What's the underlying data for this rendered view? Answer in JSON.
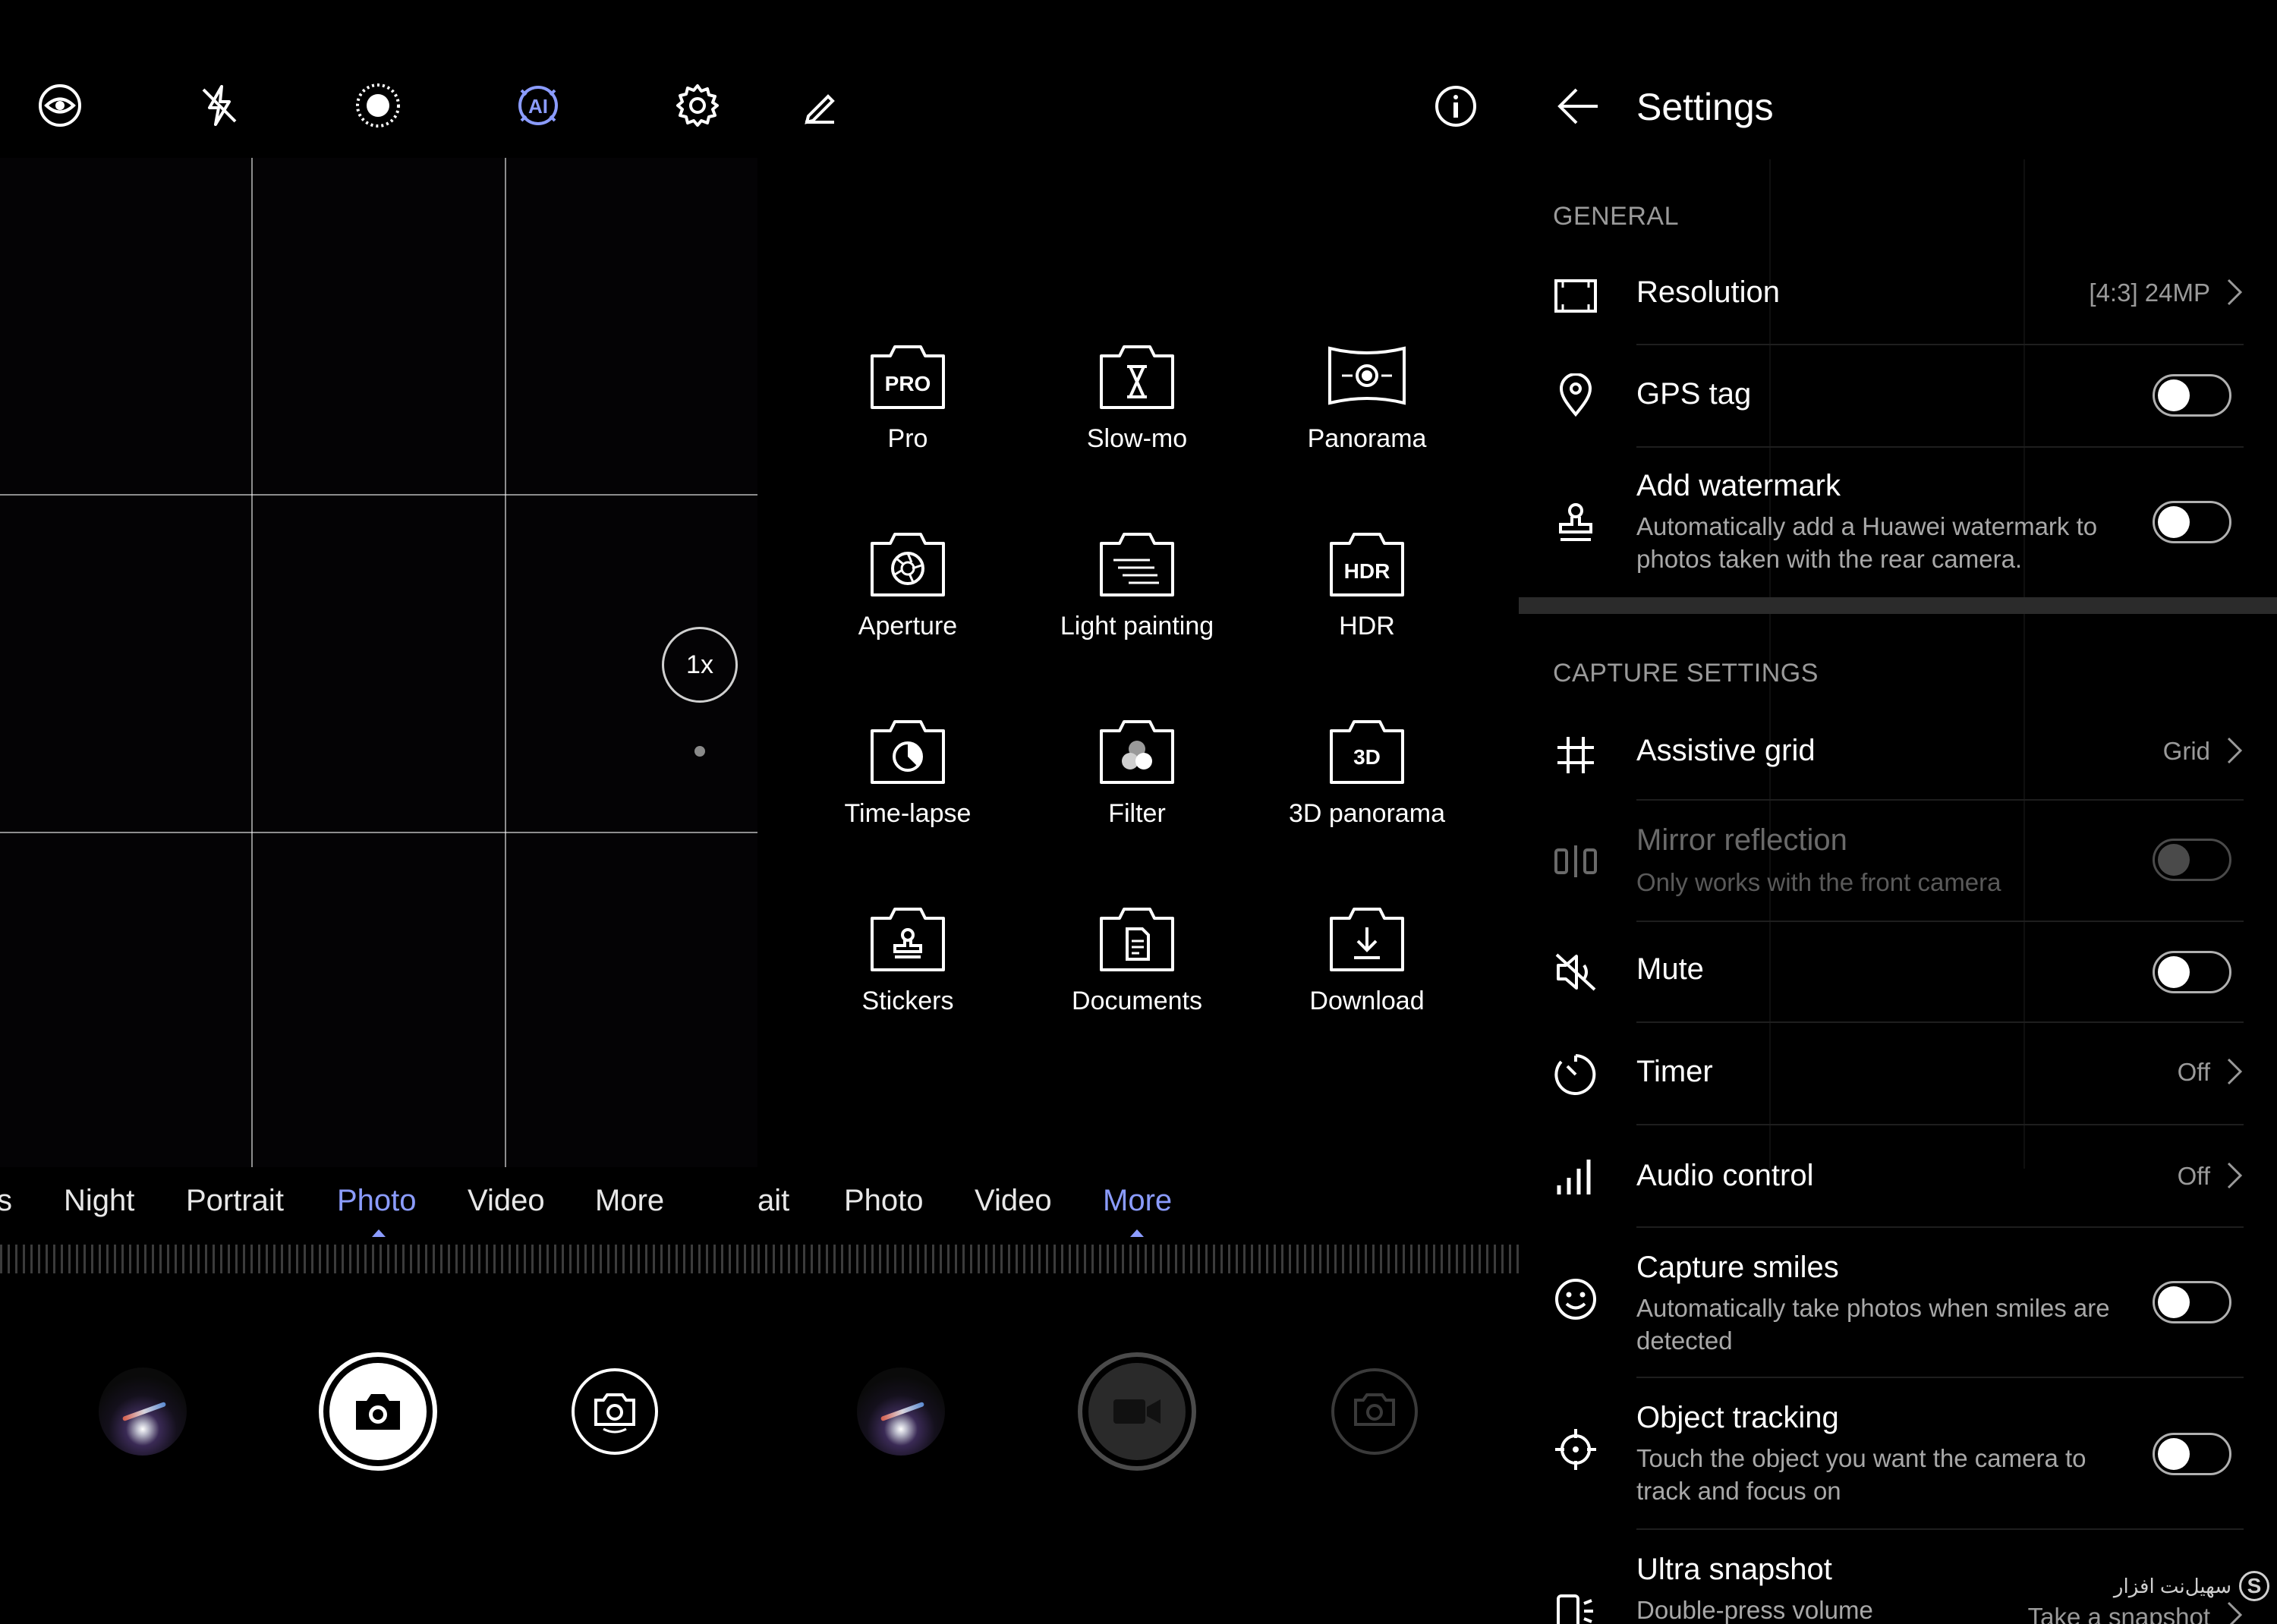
{
  "panel1": {
    "zoom_label": "1x",
    "modes": [
      "s",
      "Night",
      "Portrait",
      "Photo",
      "Video",
      "More"
    ],
    "active_mode": "Photo"
  },
  "panel2": {
    "modes": [
      "ait",
      "Photo",
      "Video",
      "More"
    ],
    "active_mode": "More",
    "grid": [
      {
        "label": "Pro",
        "icon": "pro-icon",
        "badge": "PRO"
      },
      {
        "label": "Slow-mo",
        "icon": "hourglass-icon"
      },
      {
        "label": "Panorama",
        "icon": "panorama-icon"
      },
      {
        "label": "Aperture",
        "icon": "aperture-icon"
      },
      {
        "label": "Light painting",
        "icon": "light-painting-icon"
      },
      {
        "label": "HDR",
        "icon": "hdr-icon",
        "badge": "HDR"
      },
      {
        "label": "Time-lapse",
        "icon": "time-lapse-icon"
      },
      {
        "label": "Filter",
        "icon": "filter-icon"
      },
      {
        "label": "3D panorama",
        "icon": "3d-panorama-icon",
        "badge": "3D"
      },
      {
        "label": "Stickers",
        "icon": "stickers-icon"
      },
      {
        "label": "Documents",
        "icon": "documents-icon"
      },
      {
        "label": "Download",
        "icon": "download-icon"
      }
    ]
  },
  "settings": {
    "title": "Settings",
    "general_label": "GENERAL",
    "capture_label": "CAPTURE SETTINGS",
    "resolution": {
      "title": "Resolution",
      "value": "[4:3] 24MP"
    },
    "gps": {
      "title": "GPS tag"
    },
    "watermark": {
      "title": "Add watermark",
      "sub": "Automatically add a Huawei watermark to photos taken with the rear camera."
    },
    "grid": {
      "title": "Assistive grid",
      "value": "Grid"
    },
    "mirror": {
      "title": "Mirror reflection",
      "sub": "Only works with the front camera"
    },
    "mute": {
      "title": "Mute"
    },
    "timer": {
      "title": "Timer",
      "value": "Off"
    },
    "audio": {
      "title": "Audio control",
      "value": "Off"
    },
    "smiles": {
      "title": "Capture smiles",
      "sub": "Automatically take photos when smiles are detected"
    },
    "tracking": {
      "title": "Object tracking",
      "sub": "Touch the object you want the camera to track and focus on"
    },
    "snapshot": {
      "title": "Ultra snapshot",
      "sub": "Double-press volume",
      "value": "Take a snapshot"
    }
  },
  "watermark_text": "سهیل‌نت افزار",
  "colors": {
    "accent": "#8b9cff",
    "background": "#000000"
  }
}
